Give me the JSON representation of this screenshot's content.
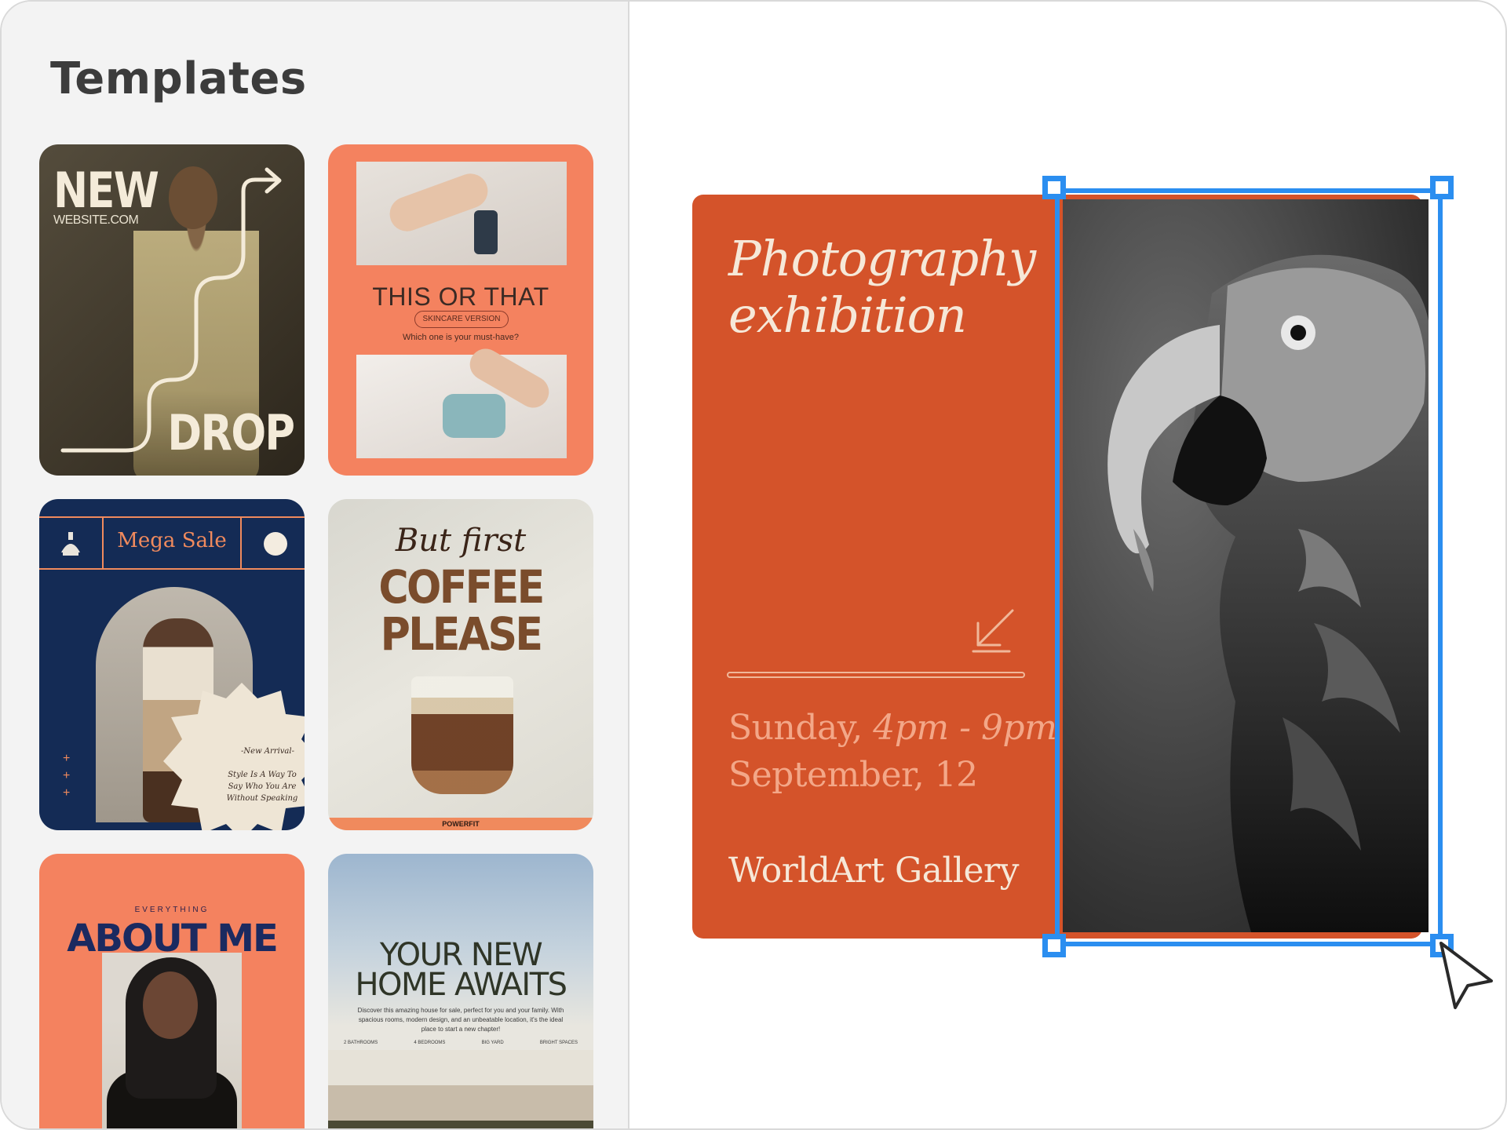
{
  "sidebar": {
    "title": "Templates",
    "templates": [
      {
        "id": "new-drop",
        "line1": "NEW",
        "line2": "WEBSITE.COM",
        "line3": "DROP"
      },
      {
        "id": "this-or-that",
        "title": "THIS OR THAT",
        "pill": "SKINCARE VERSION",
        "subtitle": "Which one is your must-have?"
      },
      {
        "id": "mega-sale",
        "title": "Mega Sale",
        "arrival": "-New Arrival-",
        "tagline": "Style Is A Way To Say Who You Are Without Speaking"
      },
      {
        "id": "coffee",
        "script": "But first",
        "line1": "COFFEE",
        "line2": "PLEASE",
        "footer": "POWERFIT"
      },
      {
        "id": "about-me",
        "eyebrow": "EVERYTHING",
        "title": "ABOUT ME"
      },
      {
        "id": "new-home",
        "line1": "YOUR NEW",
        "line2": "HOME AWAITS",
        "description": "Discover this amazing house for sale, perfect for you and your family. With spacious rooms, modern design, and an unbeatable location, it's the ideal place to start a new chapter!",
        "features": [
          "2 BATHROOMS",
          "4 BEDROOMS",
          "BIG YARD",
          "BRIGHT SPACES"
        ]
      }
    ]
  },
  "canvas": {
    "title_line1": "Photography",
    "title_line2": "exhibition",
    "day": "Sunday,",
    "time": "4pm - 9pm",
    "date": "September, 12",
    "venue": "WorldArt Gallery"
  },
  "colors": {
    "card": "#d4532a",
    "selection": "#2b8ef0",
    "sidebar_bg": "#f3f3f3"
  }
}
